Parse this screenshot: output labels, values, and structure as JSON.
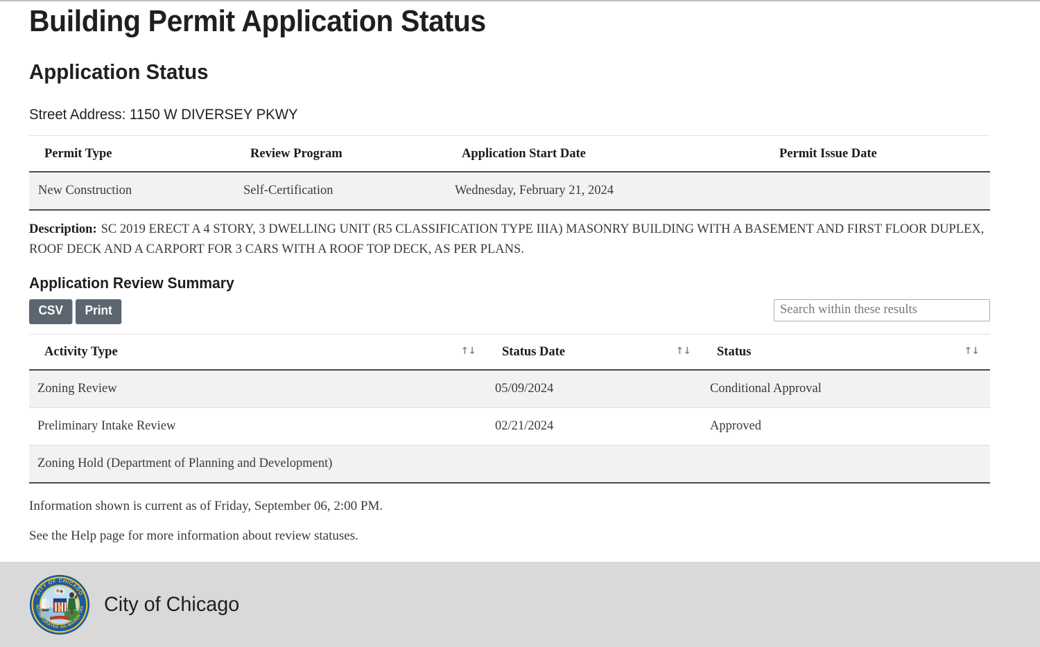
{
  "page": {
    "title": "Building Permit Application Status",
    "section_title": "Application Status",
    "street_address": "Street Address: 1150 W DIVERSEY PKWY"
  },
  "permit_table": {
    "headers": [
      "Permit Type",
      "Review Program",
      "Application Start Date",
      "Permit Issue Date"
    ],
    "rows": [
      {
        "permit_type": "New Construction",
        "review_program": "Self-Certification",
        "application_start_date": "Wednesday, February 21, 2024",
        "permit_issue_date": ""
      }
    ]
  },
  "description": {
    "label": "Description:",
    "text": "SC 2019 ERECT A 4 STORY, 3 DWELLING UNIT (R5 CLASSIFICATION TYPE IIIA) MASONRY BUILDING WITH A BASEMENT AND FIRST FLOOR DUPLEX, ROOF DECK AND A CARPORT FOR 3 CARS WITH A ROOF TOP DECK, AS PER PLANS."
  },
  "review_summary": {
    "title": "Application Review Summary",
    "toolbar": {
      "csv_label": "CSV",
      "print_label": "Print",
      "search_placeholder": "Search within these results",
      "search_value": ""
    },
    "headers": [
      "Activity Type",
      "Status Date",
      "Status"
    ],
    "sort_icon": "↑↓",
    "rows": [
      {
        "activity_type": "Zoning Review",
        "status_date": "05/09/2024",
        "status": "Conditional Approval"
      },
      {
        "activity_type": "Preliminary Intake Review",
        "status_date": "02/21/2024",
        "status": "Approved"
      },
      {
        "activity_type": "Zoning Hold (Department of Planning and Development)",
        "status_date": "",
        "status": ""
      }
    ]
  },
  "notes": {
    "current_as_of": "Information shown is current as of Friday, September 06, 2:00 PM.",
    "help": "See the Help page for more information about review statuses."
  },
  "footer": {
    "organization": "City of Chicago",
    "seal_outer_text": "CITY OF CHICAGO",
    "seal_inner_text": "INCORPORATED 4th MARCH 1831",
    "background_color": "#d9d9d9"
  },
  "colors": {
    "button_bg": "#5b6670",
    "row_alt_bg": "#f2f2f2",
    "rule_dark": "#4a4a4a",
    "seal_ring": "#1b5ba0",
    "seal_gold": "#e8c23a"
  }
}
